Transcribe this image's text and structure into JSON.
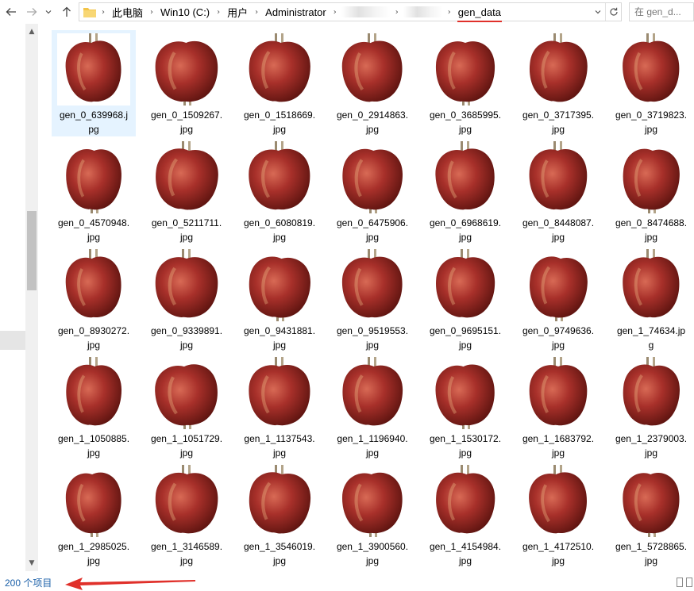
{
  "nav": {
    "back_icon": "arrow-left-icon",
    "forward_icon": "arrow-right-icon",
    "history_icon": "chevron-down-icon",
    "up_icon": "arrow-up-icon"
  },
  "address_bar": {
    "folder_icon": "folder-icon",
    "crumbs": [
      "此电脑",
      "Win10 (C:)",
      "用户",
      "Administrator",
      "",
      "",
      "gen_data"
    ],
    "dropdown_icon": "chevron-down-icon",
    "refresh_icon": "refresh-icon"
  },
  "search": {
    "placeholder": "在 gen_d..."
  },
  "files": [
    {
      "line1": "gen_0_639968.j",
      "line2": "pg",
      "selected": true
    },
    {
      "line1": "gen_0_1509267.",
      "line2": "jpg"
    },
    {
      "line1": "gen_0_1518669.",
      "line2": "jpg"
    },
    {
      "line1": "gen_0_2914863.",
      "line2": "jpg"
    },
    {
      "line1": "gen_0_3685995.",
      "line2": "jpg"
    },
    {
      "line1": "gen_0_3717395.",
      "line2": "jpg"
    },
    {
      "line1": "gen_0_3719823.",
      "line2": "jpg"
    },
    {
      "line1": "gen_0_4570948.",
      "line2": "jpg"
    },
    {
      "line1": "gen_0_5211711.",
      "line2": "jpg"
    },
    {
      "line1": "gen_0_6080819.",
      "line2": "jpg"
    },
    {
      "line1": "gen_0_6475906.",
      "line2": "jpg"
    },
    {
      "line1": "gen_0_6968619.",
      "line2": "jpg"
    },
    {
      "line1": "gen_0_8448087.",
      "line2": "jpg"
    },
    {
      "line1": "gen_0_8474688.",
      "line2": "jpg"
    },
    {
      "line1": "gen_0_8930272.",
      "line2": "jpg"
    },
    {
      "line1": "gen_0_9339891.",
      "line2": "jpg"
    },
    {
      "line1": "gen_0_9431881.",
      "line2": "jpg"
    },
    {
      "line1": "gen_0_9519553.",
      "line2": "jpg"
    },
    {
      "line1": "gen_0_9695151.",
      "line2": "jpg"
    },
    {
      "line1": "gen_0_9749636.",
      "line2": "jpg"
    },
    {
      "line1": "gen_1_74634.jp",
      "line2": "g"
    },
    {
      "line1": "gen_1_1050885.",
      "line2": "jpg"
    },
    {
      "line1": "gen_1_1051729.",
      "line2": "jpg"
    },
    {
      "line1": "gen_1_1137543.",
      "line2": "jpg"
    },
    {
      "line1": "gen_1_1196940.",
      "line2": "jpg"
    },
    {
      "line1": "gen_1_1530172.",
      "line2": "jpg"
    },
    {
      "line1": "gen_1_1683792.",
      "line2": "jpg"
    },
    {
      "line1": "gen_1_2379003.",
      "line2": "jpg"
    },
    {
      "line1": "gen_1_2985025.",
      "line2": "jpg"
    },
    {
      "line1": "gen_1_3146589.",
      "line2": "jpg"
    },
    {
      "line1": "gen_1_3546019.",
      "line2": "jpg"
    },
    {
      "line1": "gen_1_3900560.",
      "line2": "jpg"
    },
    {
      "line1": "gen_1_4154984.",
      "line2": "jpg"
    },
    {
      "line1": "gen_1_4172510.",
      "line2": "jpg"
    },
    {
      "line1": "gen_1_5728865.",
      "line2": "jpg"
    }
  ],
  "status_bar": {
    "item_count": "200 个项目",
    "details_view_icon": "details-view-icon",
    "large_icons_view_icon": "large-icons-view-icon"
  },
  "colors": {
    "accent_red": "#e0302a",
    "selection_bg": "#e5f3ff",
    "status_text": "#1a5fa8",
    "apple_red": "#a8302a",
    "apple_dark": "#5e1410"
  }
}
